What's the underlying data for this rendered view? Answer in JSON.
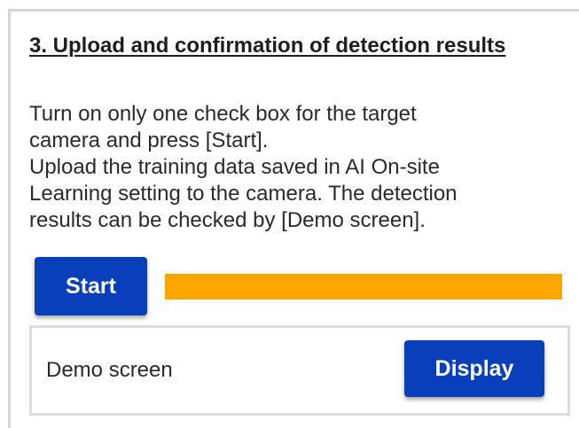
{
  "section": {
    "heading": "3. Upload and confirmation of detection results",
    "description_lines": [
      "Turn on only one check box for the target",
      "camera and press [Start].",
      "Upload the training data saved in AI On-site",
      "Learning setting to the camera. The detection",
      "results can be checked by [Demo screen]."
    ]
  },
  "start": {
    "button_label": "Start",
    "progress_fraction": 1.0,
    "progress_color": "#ffa500"
  },
  "demo": {
    "label": "Demo screen",
    "button_label": "Display"
  },
  "colors": {
    "button_bg": "#0a3fbc",
    "panel_border": "#d6d6d6"
  }
}
